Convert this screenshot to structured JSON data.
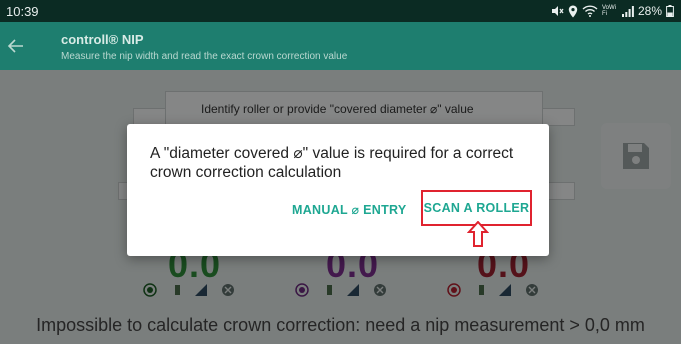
{
  "status_bar": {
    "time": "10:39",
    "vowifi": "VoWiFi",
    "battery_percent": "28%"
  },
  "app_bar": {
    "title": "controll® NIP",
    "subtitle": "Measure the nip width and read the exact crown correction value",
    "back_icon": "arrow-left-icon"
  },
  "background": {
    "panel_text": "Identify roller or provide \"covered diameter ⌀\" value",
    "save_icon": "floppy-disk-icon",
    "gauges": [
      {
        "value": "0.0",
        "color": "#2f8a3a",
        "dot_color": "#1c5c25"
      },
      {
        "value": "0.0",
        "color": "#7a2f8c",
        "dot_color": "#6a2a7c"
      },
      {
        "value": "0.0",
        "color": "#9b2230",
        "dot_color": "#b0202e"
      }
    ],
    "status_message": "Impossible to calculate crown correction: need a nip measurement > 0,0 mm"
  },
  "dialog": {
    "message": "A \"diameter covered ⌀\" value is required for a correct crown correction calculation",
    "manual_button": "MANUAL ⌀ ENTRY",
    "scan_button": "SCAN A ROLLER",
    "highlight_color": "#e0232f",
    "accent_color": "#1ea792"
  }
}
